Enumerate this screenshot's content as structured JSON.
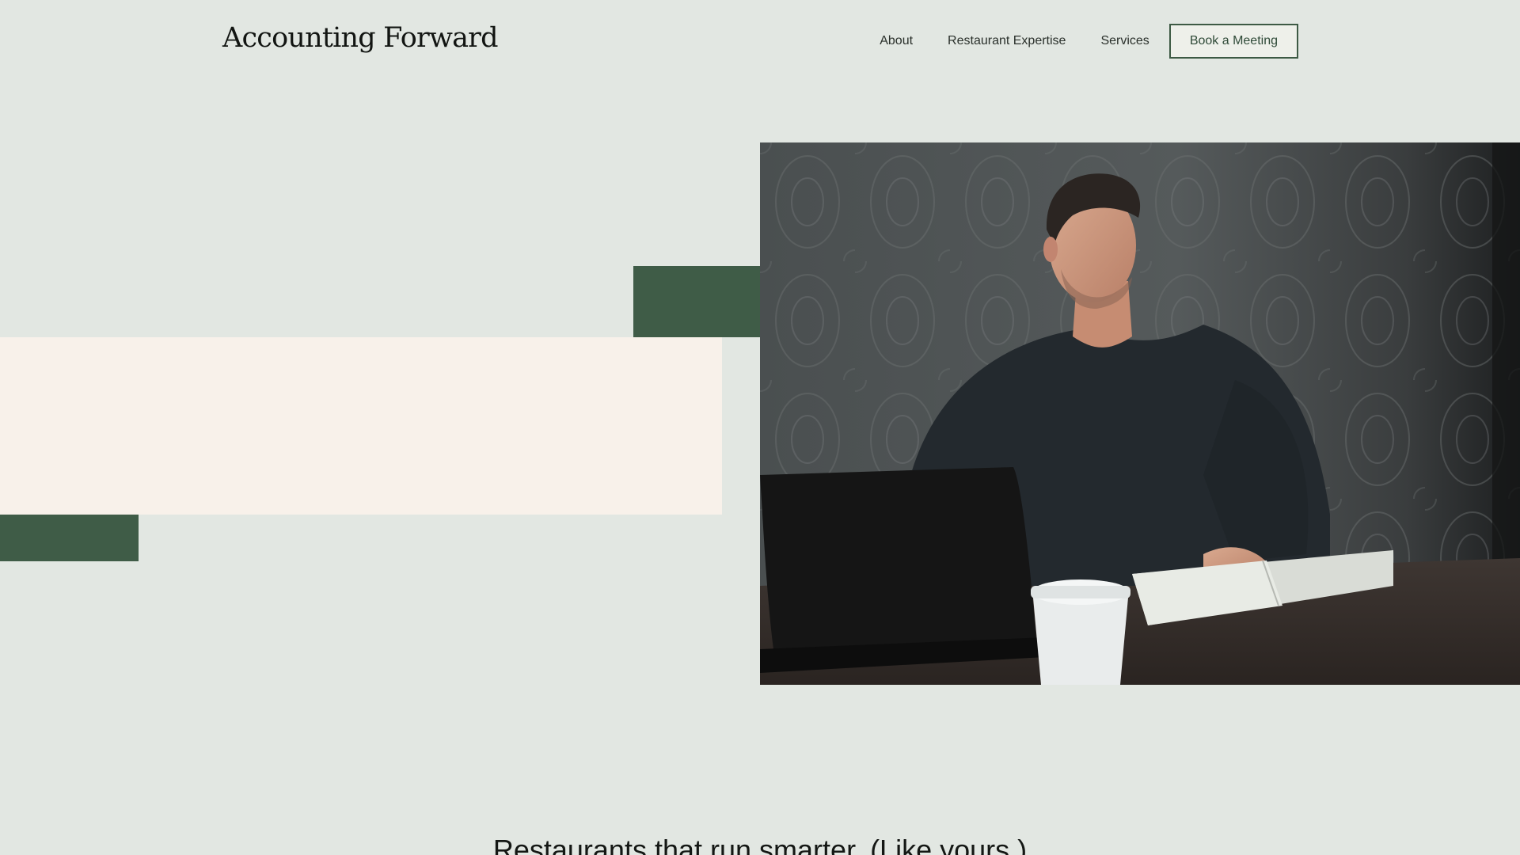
{
  "brand": {
    "name": "Accounting Forward"
  },
  "nav": {
    "items": [
      {
        "label": "About"
      },
      {
        "label": "Restaurant Expertise"
      },
      {
        "label": "Services"
      }
    ],
    "cta_label": "Book a Meeting"
  },
  "hero": {
    "photo_subject": "man in dark sweater seated at table with laptop, coffee cup and notebook"
  },
  "section": {
    "headline": "Restaurants that run smarter. (Like yours.)"
  },
  "colors": {
    "background": "#e2e7e2",
    "accent_green": "#3f5c47",
    "cream": "#f8f1ea",
    "cta_border": "#3d5a44"
  }
}
